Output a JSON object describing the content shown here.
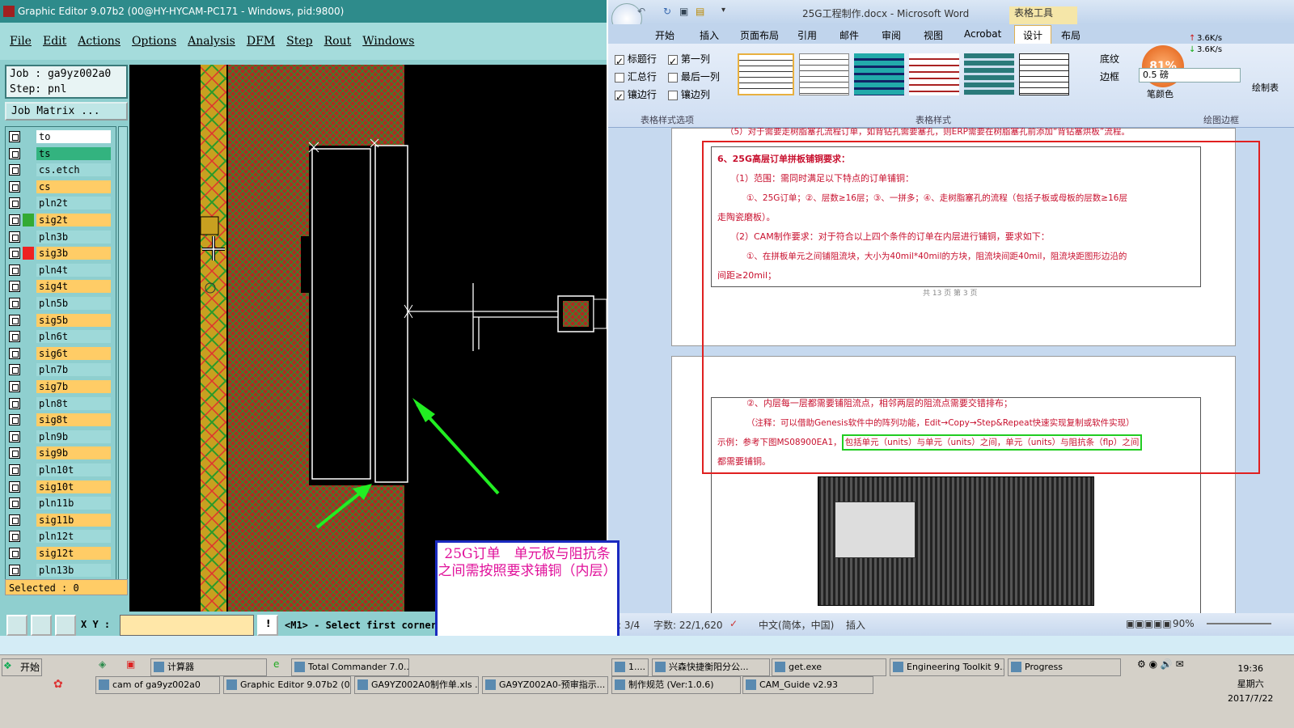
{
  "ge": {
    "title": "Graphic Editor 9.07b2 (00@HY-HYCAM-PC171 - Windows, pid:9800)",
    "menu": [
      "File",
      "Edit",
      "Actions",
      "Options",
      "Analysis",
      "DFM",
      "Step",
      "Rout",
      "Windows"
    ],
    "job_label": "Job : ga9yz002a0",
    "step_label": "Step: pnl",
    "job_matrix": "Job Matrix ...",
    "layers": [
      {
        "name": "to",
        "bg": "#ffffff",
        "mark": ""
      },
      {
        "name": "ts",
        "bg": "#33b37f",
        "mark": ""
      },
      {
        "name": "cs.etch",
        "bg": "#9ed9d9",
        "mark": ""
      },
      {
        "name": "cs",
        "bg": "#ffcc66",
        "mark": ""
      },
      {
        "name": "pln2t",
        "bg": "#9ed9d9",
        "mark": ""
      },
      {
        "name": "sig2t",
        "bg": "#ffcc66",
        "mark": "#33aa33"
      },
      {
        "name": "pln3b",
        "bg": "#9ed9d9",
        "mark": ""
      },
      {
        "name": "sig3b",
        "bg": "#ffcc66",
        "mark": "#ee2222"
      },
      {
        "name": "pln4t",
        "bg": "#9ed9d9",
        "mark": ""
      },
      {
        "name": "sig4t",
        "bg": "#ffcc66",
        "mark": ""
      },
      {
        "name": "pln5b",
        "bg": "#9ed9d9",
        "mark": ""
      },
      {
        "name": "sig5b",
        "bg": "#ffcc66",
        "mark": ""
      },
      {
        "name": "pln6t",
        "bg": "#9ed9d9",
        "mark": ""
      },
      {
        "name": "sig6t",
        "bg": "#ffcc66",
        "mark": ""
      },
      {
        "name": "pln7b",
        "bg": "#9ed9d9",
        "mark": ""
      },
      {
        "name": "sig7b",
        "bg": "#ffcc66",
        "mark": ""
      },
      {
        "name": "pln8t",
        "bg": "#9ed9d9",
        "mark": ""
      },
      {
        "name": "sig8t",
        "bg": "#ffcc66",
        "mark": ""
      },
      {
        "name": "pln9b",
        "bg": "#9ed9d9",
        "mark": ""
      },
      {
        "name": "sig9b",
        "bg": "#ffcc66",
        "mark": ""
      },
      {
        "name": "pln10t",
        "bg": "#9ed9d9",
        "mark": ""
      },
      {
        "name": "sig10t",
        "bg": "#ffcc66",
        "mark": ""
      },
      {
        "name": "pln11b",
        "bg": "#9ed9d9",
        "mark": ""
      },
      {
        "name": "sig11b",
        "bg": "#ffcc66",
        "mark": ""
      },
      {
        "name": "pln12t",
        "bg": "#9ed9d9",
        "mark": ""
      },
      {
        "name": "sig12t",
        "bg": "#ffcc66",
        "mark": ""
      },
      {
        "name": "pln13b",
        "bg": "#9ed9d9",
        "mark": ""
      }
    ],
    "selected": "Selected : 0",
    "xy_label": "X Y :",
    "xy_value": "",
    "status_msg": "<M1> - Select first corner"
  },
  "popup": {
    "text": "25G订单　单元板与阻抗条之间需按照要求铺铜（内层）"
  },
  "word": {
    "title": "25G工程制作.docx - Microsoft Word",
    "context_tab": "表格工具",
    "tabs": [
      "开始",
      "插入",
      "页面布局",
      "引用",
      "邮件",
      "审阅",
      "视图",
      "Acrobat",
      "设计",
      "布局"
    ],
    "active_tab": "设计",
    "style_options": [
      "标题行",
      "第一列",
      "汇总行",
      "最后一列",
      "镶边行",
      "镶边列"
    ],
    "group_options": "表格样式选项",
    "group_styles": "表格样式",
    "group_borders": "绘图边框",
    "shading": "底纹",
    "borders": "边框",
    "pen_weight": "0.5 磅",
    "pen_color": "笔颜色",
    "draw_table": "绘制表",
    "net_pct": "81%",
    "net_up": "3.6K/s",
    "net_down": "3.6K/s",
    "doc": {
      "line0": "（5）对于需要走树脂塞孔流程订单，如背钻孔需要塞孔，则ERP需要在树脂塞孔前添加“背钻塞烘板”流程。",
      "h6": "6、25G高层订单拼板铺铜要求：",
      "h1": "（1）范围：需同时满足以下特点的订单铺铜：",
      "p1a": "①、25G订单；②、层数≥16层；③、一拼多；④、走树脂塞孔的流程（包括子板或母板的层数≥16层",
      "p1b": "走陶瓷磨板）。",
      "h2": "（2）CAM制作要求：对于符合以上四个条件的订单在内层进行铺铜，要求如下：",
      "p2a": "①、在拼板单元之间铺阻流块，大小为40mil*40mil的方块，阻流块间距40mil，阻流块距图形边沿的",
      "p2b": "间距≥20mil；",
      "footer": "共 13 页 第 3 页",
      "p3": "②、内层每一层都需要铺阻流点，相邻两层的阻流点需要交错排布；",
      "p4": "（注释：可以借助Genesis软件中的阵列功能，Edit→Copy→Step&Repeat快速实现复制或软件实现）",
      "p5a": "示例：参考下图MS08900EA1，",
      "p5b": "包括单元（units）与单元（units）之间，单元（units）与阻抗条（flp）之间",
      "p6": "都需要铺铜。"
    },
    "status": {
      "page": "面: 3/4",
      "words": "字数: 22/1,620",
      "lang": "中文(简体，中国)",
      "insert": "插入",
      "zoom": "90%"
    }
  },
  "taskbar": {
    "start": "开始",
    "row1": [
      "计算器",
      "Total Commander 7.0...",
      "1....",
      "兴森快捷衡阳分公...",
      "get.exe",
      "Engineering Toolkit 9....",
      "Progress"
    ],
    "row2": [
      "cam of ga9yz002a0",
      "Graphic Editor 9.07b2 (0...",
      "GA9YZ002A0制作单.xls ...",
      "GA9YZ002A0-预审指示...",
      "制作规范 (Ver:1.0.6)",
      "CAM_Guide v2.93"
    ],
    "clock_time": "19:36",
    "clock_day": "星期六",
    "clock_date": "2017/7/22"
  }
}
